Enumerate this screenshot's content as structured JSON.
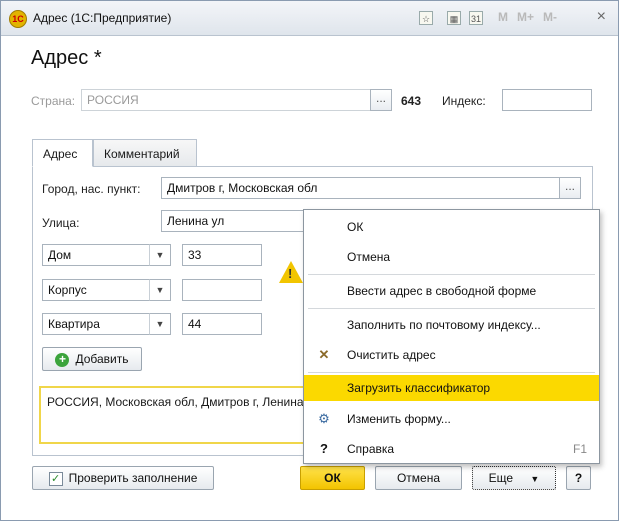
{
  "window": {
    "title": "Адрес (1С:Предприятие)",
    "logo_text": "1С",
    "close_glyph": "×"
  },
  "titlebar_tools": [
    "M",
    "M+",
    "M-"
  ],
  "page": {
    "heading": "Адрес *"
  },
  "country": {
    "label": "Страна:",
    "value": "РОССИЯ",
    "code": "643",
    "index_label": "Индекс:",
    "index_value": ""
  },
  "tabs": [
    {
      "label": "Адрес",
      "active": true
    },
    {
      "label": "Комментарий",
      "active": false
    }
  ],
  "address": {
    "city_label": "Город, нас. пункт:",
    "city_value": "Дмитров г, Московская обл",
    "street_label": "Улица:",
    "street_value": "Ленина ул",
    "rows": [
      {
        "type": "Дом",
        "value": "33"
      },
      {
        "type": "Корпус",
        "value": ""
      },
      {
        "type": "Квартира",
        "value": "44"
      }
    ],
    "add_label": "Добавить",
    "summary": "РОССИЯ, Московская обл, Дмитров г, Ленина ул"
  },
  "dots": "...",
  "bottom": {
    "check_label": "Проверить заполнение",
    "ok_label": "ОК",
    "cancel_label": "Отмена",
    "more_label": "Еще",
    "help_label": "?"
  },
  "menu": {
    "items": [
      {
        "label": "ОК",
        "icon": "",
        "shortcut": ""
      },
      {
        "label": "Отмена",
        "icon": "",
        "shortcut": ""
      },
      {
        "label": "Ввести адрес в свободной форме",
        "icon": "",
        "shortcut": ""
      },
      {
        "label": "Заполнить по почтовому индексу...",
        "icon": "",
        "shortcut": ""
      },
      {
        "label": "Очистить адрес",
        "icon": "✕",
        "shortcut": ""
      },
      {
        "label": "Загрузить классификатор",
        "icon": "",
        "shortcut": ""
      },
      {
        "label": "Изменить форму...",
        "icon": "⚙",
        "shortcut": ""
      },
      {
        "label": "Справка",
        "icon": "?",
        "shortcut": "F1"
      }
    ]
  },
  "colors": {
    "accent": "#fbd900",
    "primary_button": "#f3c400",
    "frame": "#8a9bb0"
  }
}
